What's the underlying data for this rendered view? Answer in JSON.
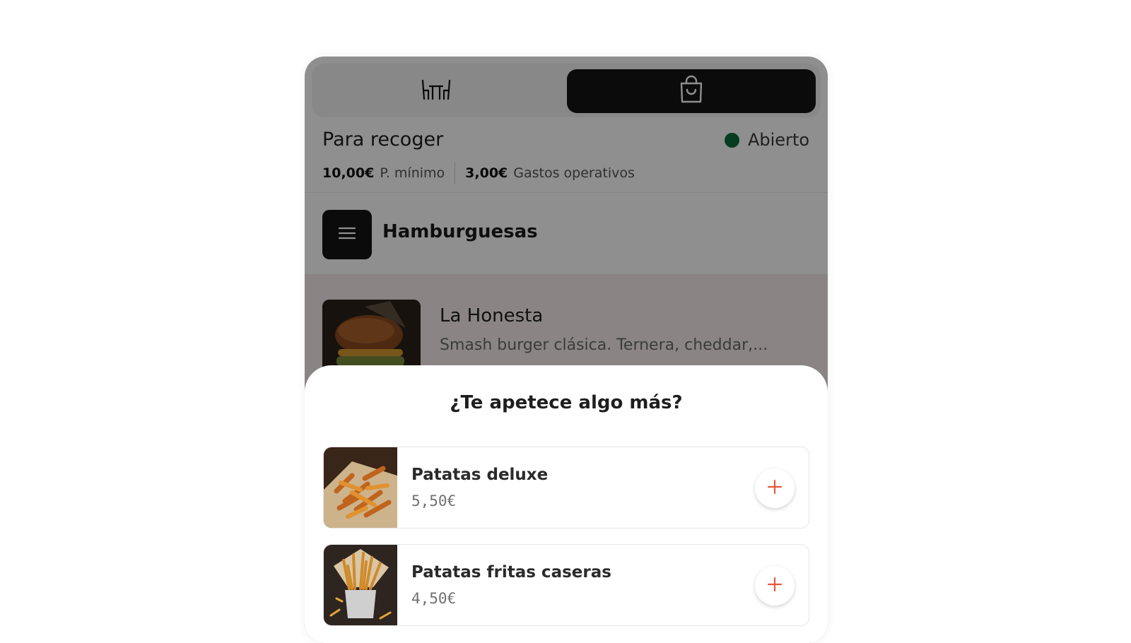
{
  "mode_switch": {
    "dine_in_icon": "table-chairs-icon",
    "pickup_icon": "shopping-bag-icon",
    "selected": "pickup"
  },
  "store_info": {
    "title": "Para recoger",
    "status": "Abierto",
    "status_color": "#0b6b3a",
    "min_order_value": "10,00€",
    "min_order_label": "P. mínimo",
    "fee_value": "3,00€",
    "fee_label": "Gastos operativos"
  },
  "category": {
    "menu_icon": "hamburger-menu-icon",
    "title": "Hamburguesas"
  },
  "product": {
    "name": "La Honesta",
    "description": "Smash burger clásica. Ternera, cheddar,..."
  },
  "upsell_sheet": {
    "title": "¿Te apetece algo más?",
    "items": [
      {
        "name": "Patatas deluxe",
        "price": "5,50€",
        "image": "fries-deluxe-photo"
      },
      {
        "name": "Patatas fritas caseras",
        "price": "4,50€",
        "image": "homemade-fries-photo"
      }
    ],
    "add_icon": "plus-icon",
    "accent_color": "#e8573c"
  },
  "overlay_color": "rgba(0,0,0,0.44)"
}
